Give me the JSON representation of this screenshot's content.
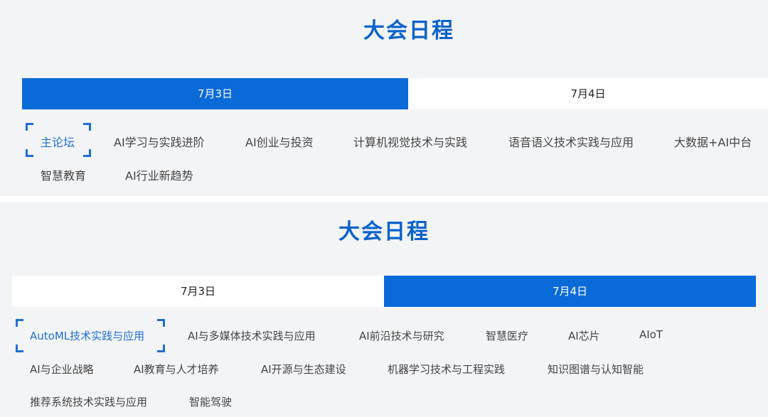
{
  "panel1": {
    "title": "大会日程",
    "tabs": [
      {
        "label": "7月3日",
        "active": true
      },
      {
        "label": "7月4日",
        "active": false
      }
    ],
    "items": [
      "主论坛",
      "AI学习与实践进阶",
      "AI创业与投资",
      "计算机视觉技术与实践",
      "语音语义技术实践与应用",
      "大数据+AI中台",
      "智慧教育",
      "AI行业新趋势"
    ],
    "selected_item": "主论坛"
  },
  "panel2": {
    "title": "大会日程",
    "tabs": [
      {
        "label": "7月3日",
        "active": false
      },
      {
        "label": "7月4日",
        "active": true
      }
    ],
    "items": [
      "AutoML技术实践与应用",
      "AI与多媒体技术实践与应用",
      "AI前沿技术与研究",
      "智慧医疗",
      "AI芯片",
      "AIoT",
      "AI与企业战略",
      "AI教育与人才培养",
      "AI开源与生态建设",
      "机器学习技术与工程实践",
      "知识图谱与认知智能",
      "推荐系统技术实践与应用",
      "智能驾驶"
    ],
    "selected_item": "AutoML技术实践与应用"
  },
  "colors": {
    "accent": "#0a6ad8",
    "title": "#0a63c9",
    "background": "#f3f4f6"
  }
}
